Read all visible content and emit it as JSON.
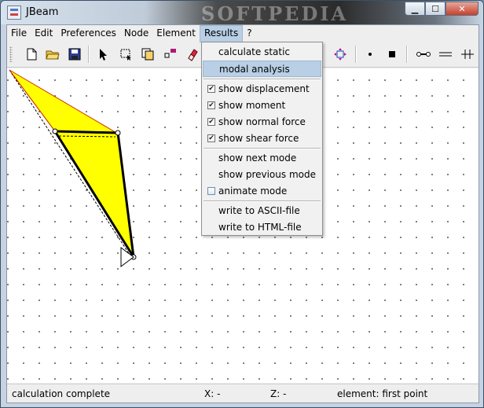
{
  "window": {
    "title": "JBeam",
    "watermark": "SOFTPEDIA"
  },
  "menubar": {
    "items": [
      "File",
      "Edit",
      "Preferences",
      "Node",
      "Element",
      "Results",
      "?"
    ],
    "active": "Results"
  },
  "results_menu": {
    "group1": [
      "calculate static",
      "modal analysis"
    ],
    "group2": [
      {
        "label": "show displacement",
        "checked": true
      },
      {
        "label": "show moment",
        "checked": true
      },
      {
        "label": "show normal force",
        "checked": true
      },
      {
        "label": "show shear force",
        "checked": true
      }
    ],
    "group3": [
      {
        "label": "show next mode"
      },
      {
        "label": "show previous mode"
      },
      {
        "label": "animate mode",
        "checked": false
      }
    ],
    "group4": [
      "write to ASCII-file",
      "write to HTML-file"
    ],
    "highlighted": "modal analysis"
  },
  "toolbar": {
    "icons": [
      "new-file-icon",
      "open-folder-icon",
      "save-icon",
      "select-arrow-icon",
      "select-rectangle-icon",
      "copy-icon",
      "add-node-icon",
      "eraser-icon",
      "fit-view-icon",
      "small-point-icon",
      "large-point-icon",
      "link-icon",
      "hinge-icon",
      "support-icon"
    ]
  },
  "statusbar": {
    "message": "calculation complete",
    "x": "X: -",
    "z": "Z: -",
    "element": "element: first point"
  },
  "colors": {
    "fill": "#ffff00",
    "menu_highlight": "#b8cfe5",
    "beam_outline": "#cc3300"
  }
}
